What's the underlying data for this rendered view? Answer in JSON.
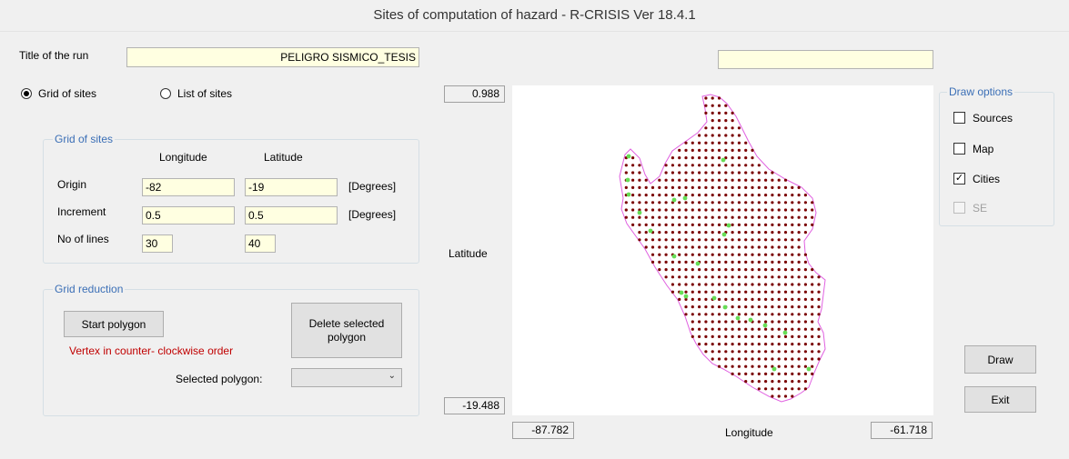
{
  "window": {
    "title": "Sites of computation of hazard - R-CRISIS Ver 18.4.1"
  },
  "run": {
    "title_label": "Title of the run",
    "title_value": "PELIGRO SISMICO_TESIS",
    "extra_field_value": ""
  },
  "mode": {
    "grid_label": "Grid of sites",
    "list_label": "List of sites",
    "selected": "grid"
  },
  "grid": {
    "group_label": "Grid of sites",
    "col_longitude": "Longitude",
    "col_latitude": "Latitude",
    "origin_label": "Origin",
    "origin_lon": "-82",
    "origin_lat": "-19",
    "origin_unit": "[Degrees]",
    "increment_label": "Increment",
    "increment_lon": "0.5",
    "increment_lat": "0.5",
    "increment_unit": "[Degrees]",
    "lines_label": "No of lines",
    "lines_lon": "30",
    "lines_lat": "40"
  },
  "reduction": {
    "group_label": "Grid reduction",
    "start_polygon": "Start polygon",
    "delete_polygon": "Delete selected polygon",
    "vertex_note": "Vertex in counter- clockwise order",
    "selected_polygon_label": "Selected polygon:",
    "selected_polygon_value": ""
  },
  "map": {
    "lat_max": "0.988",
    "lat_min": "-19.488",
    "lon_min": "-87.782",
    "lon_max": "-61.718",
    "lat_axis_label": "Latitude",
    "lon_axis_label": "Longitude",
    "site_color": "#7a0000",
    "city_color": "#66dd55",
    "outline_color": "#e060e0"
  },
  "draw_options": {
    "group_label": "Draw options",
    "sources_label": "Sources",
    "sources_checked": false,
    "map_label": "Map",
    "map_checked": false,
    "cities_label": "Cities",
    "cities_checked": true,
    "se_label": "SE",
    "se_checked": false,
    "se_enabled": false
  },
  "buttons": {
    "draw": "Draw",
    "exit": "Exit"
  }
}
